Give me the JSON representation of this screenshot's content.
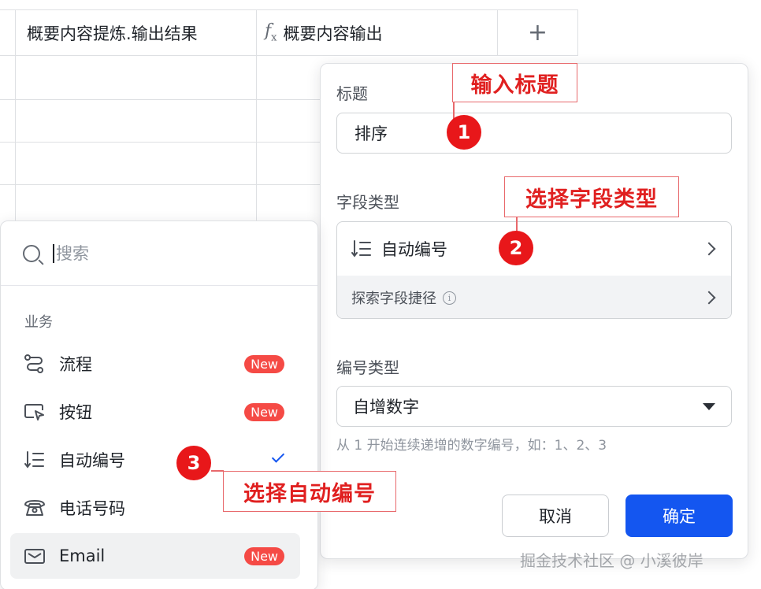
{
  "sheet": {
    "col_result": "概要内容提炼.输出结果",
    "col_output": "概要内容输出",
    "add_column": "+"
  },
  "panel": {
    "title_label": "标题",
    "title_value": "排序",
    "field_type_label": "字段类型",
    "field_type_value": "自动编号",
    "explore_shortcut": "探索字段捷径",
    "info_glyph": "i",
    "number_type_label": "编号类型",
    "number_type_value": "自增数字",
    "number_type_hint": "从 1 开始连续递增的数字编号，如：1、2、3",
    "cancel": "取消",
    "confirm": "确定"
  },
  "dropdown": {
    "search_placeholder": "搜索",
    "section": "业务",
    "items": [
      {
        "label": "流程",
        "icon": "flow-icon",
        "badge": "New"
      },
      {
        "label": "按钮",
        "icon": "button-icon",
        "badge": "New"
      },
      {
        "label": "自动编号",
        "icon": "auto-number-icon",
        "selected": true
      },
      {
        "label": "电话号码",
        "icon": "phone-icon"
      },
      {
        "label": "Email",
        "icon": "email-icon",
        "badge": "New"
      }
    ]
  },
  "annotations": {
    "step1_label": "输入标题",
    "step1_num": "1",
    "step2_label": "选择字段类型",
    "step2_num": "2",
    "step3_label": "选择自动编号",
    "step3_num": "3"
  },
  "watermark": "掘金技术社区 @ 小溪彼岸",
  "colors": {
    "accent": "#1456f0",
    "badge": "#f54a45",
    "annotation": "#e8171a"
  }
}
